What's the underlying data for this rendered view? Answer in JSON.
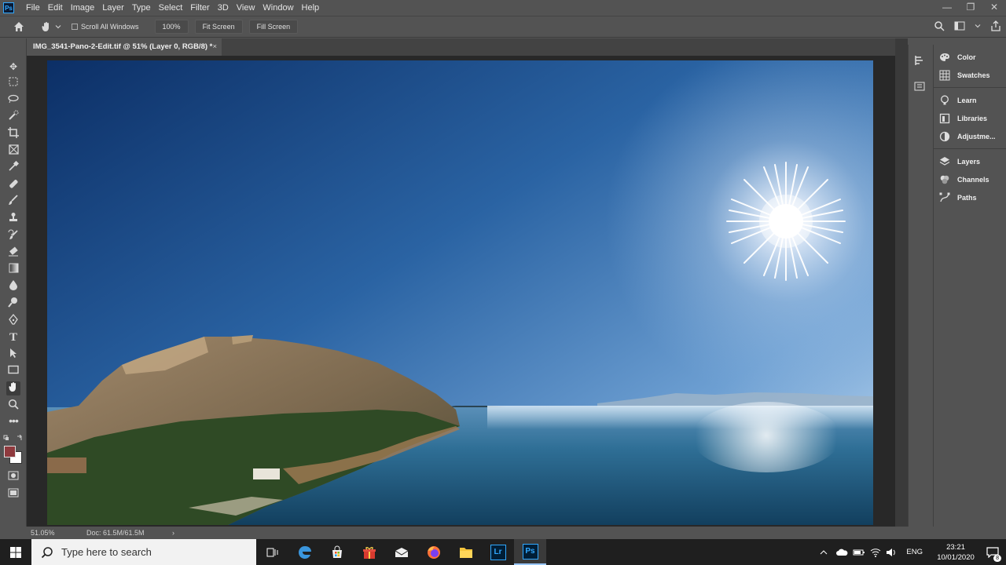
{
  "app": {
    "logo": "Ps"
  },
  "menu": [
    "File",
    "Edit",
    "Image",
    "Layer",
    "Type",
    "Select",
    "Filter",
    "3D",
    "View",
    "Window",
    "Help"
  ],
  "window_controls": {
    "minimize": "—",
    "restore": "❐",
    "close": "✕"
  },
  "options": {
    "scroll_all_label": "Scroll All Windows",
    "zoom_value": "100%",
    "fit_screen": "Fit Screen",
    "fill_screen": "Fill Screen"
  },
  "document": {
    "tab_title": "IMG_3541-Pano-2-Edit.tif @ 51% (Layer 0, RGB/8) *",
    "close": "×"
  },
  "tools": [
    "move-icon",
    "marquee-icon",
    "lasso-icon",
    "quick-select-icon",
    "crop-icon",
    "frame-icon",
    "eyedropper-icon",
    "healing-icon",
    "brush-icon",
    "stamp-icon",
    "history-brush-icon",
    "eraser-icon",
    "gradient-icon",
    "blur-icon",
    "dodge-icon",
    "pen-icon",
    "type-icon",
    "path-select-icon",
    "rectangle-icon",
    "hand-icon",
    "zoom-icon",
    "more-icon"
  ],
  "colors": {
    "foreground": "#8f3a3e",
    "background": "#ffffff",
    "accent": "#31a8ff"
  },
  "panels": {
    "group1": [
      "Color",
      "Swatches"
    ],
    "group2": [
      "Learn",
      "Libraries",
      "Adjustme..."
    ],
    "group3": [
      "Layers",
      "Channels",
      "Paths"
    ]
  },
  "status": {
    "zoom": "51.05%",
    "doc": "Doc: 61.5M/61.5M",
    "arrow": "›"
  },
  "taskbar": {
    "search_placeholder": "Type here to search",
    "apps": [
      "task-view-icon",
      "edge-icon",
      "store-icon",
      "gift-icon",
      "mail-icon",
      "firefox-icon",
      "file-explorer-icon",
      "lightroom-icon",
      "photoshop-icon"
    ],
    "lr_label": "Lr",
    "ps_label": "Ps",
    "lang": "ENG",
    "time": "23:21",
    "date": "10/01/2020",
    "notif_count": "8"
  }
}
